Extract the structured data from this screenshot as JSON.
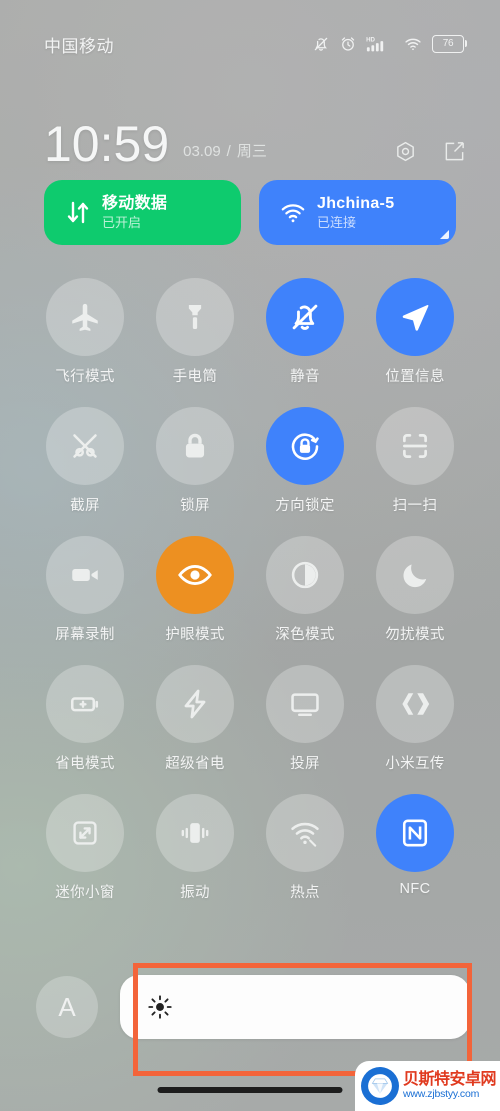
{
  "statusbar": {
    "carrier": "中国移动",
    "icons": [
      "mute-bell-icon",
      "alarm-icon",
      "hd-signal-icon",
      "wifi-icon",
      "battery-icon"
    ],
    "battery_level": "76",
    "hd_label": "HD"
  },
  "clock": {
    "time": "10:59",
    "date": "03.09",
    "separator": "/",
    "weekday": "周三",
    "settings_icon": "gear-icon",
    "edit_icon": "edit-icon"
  },
  "connectivity": [
    {
      "title": "移动数据",
      "subtitle": "已开启",
      "icon": "mobile-data-icon",
      "color": "#0ecb6e",
      "state": "on",
      "expandable": false
    },
    {
      "title": "Jhchina-5",
      "subtitle": "已连接",
      "icon": "wifi-icon",
      "color": "#3f82fb",
      "state": "on",
      "expandable": true
    }
  ],
  "toggles": [
    {
      "label": "飞行模式",
      "icon": "airplane-icon",
      "state": "off"
    },
    {
      "label": "手电筒",
      "icon": "flashlight-icon",
      "state": "off"
    },
    {
      "label": "静音",
      "icon": "bell-mute-icon",
      "state": "on",
      "accent": "#3f82fb"
    },
    {
      "label": "位置信息",
      "icon": "location-arrow-icon",
      "state": "on",
      "accent": "#3f82fb"
    },
    {
      "label": "截屏",
      "icon": "screenshot-icon",
      "state": "off"
    },
    {
      "label": "锁屏",
      "icon": "lock-icon",
      "state": "off"
    },
    {
      "label": "方向锁定",
      "icon": "rotation-lock-icon",
      "state": "on",
      "accent": "#3f82fb"
    },
    {
      "label": "扫一扫",
      "icon": "scan-icon",
      "state": "off"
    },
    {
      "label": "屏幕录制",
      "icon": "video-camera-icon",
      "state": "off"
    },
    {
      "label": "护眼模式",
      "icon": "eye-icon",
      "state": "on",
      "accent": "#ed9021"
    },
    {
      "label": "深色模式",
      "icon": "contrast-icon",
      "state": "off"
    },
    {
      "label": "勿扰模式",
      "icon": "moon-icon",
      "state": "off"
    },
    {
      "label": "省电模式",
      "icon": "battery-plus-icon",
      "state": "off"
    },
    {
      "label": "超级省电",
      "icon": "lightning-icon",
      "state": "off"
    },
    {
      "label": "投屏",
      "icon": "monitor-icon",
      "state": "off"
    },
    {
      "label": "小米互传",
      "icon": "mi-share-icon",
      "state": "off"
    },
    {
      "label": "迷你小窗",
      "icon": "mini-window-icon",
      "state": "off"
    },
    {
      "label": "振动",
      "icon": "vibrate-icon",
      "state": "off"
    },
    {
      "label": "热点",
      "icon": "hotspot-icon",
      "state": "off"
    },
    {
      "label": "NFC",
      "icon": "nfc-icon",
      "state": "on",
      "accent": "#3f82fb"
    }
  ],
  "brightness": {
    "auto_label": "A",
    "auto_icon": "auto-brightness-icon",
    "slider_icon": "sun-icon",
    "value_percent": 100
  },
  "annotation": {
    "shape": "rectangle",
    "color": "#f3643a"
  },
  "watermark": {
    "site_name": "贝斯特安卓网",
    "url": "www.zjbstyy.com",
    "logo_icon": "gem-logo-icon"
  }
}
